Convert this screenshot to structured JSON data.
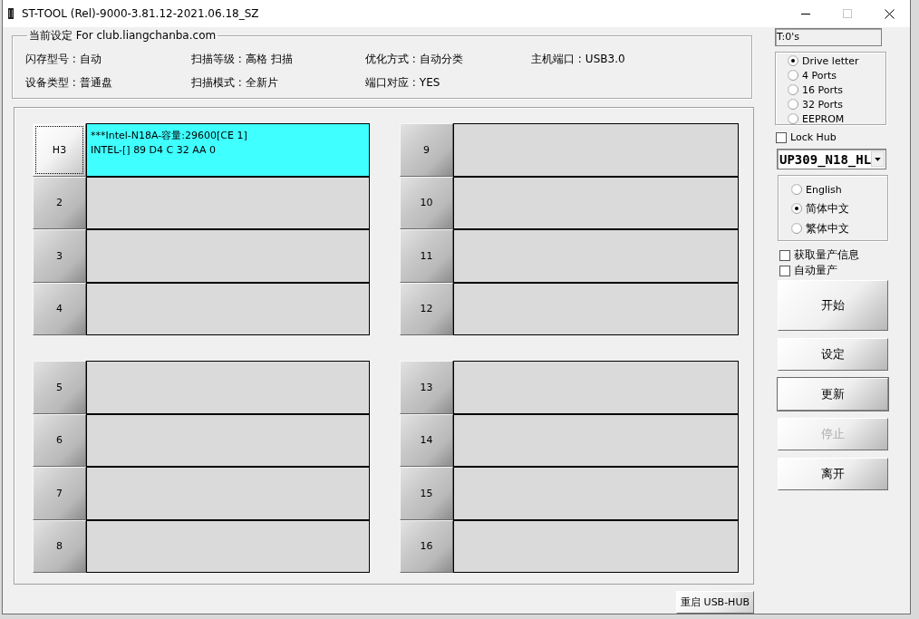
{
  "window": {
    "title": "ST-TOOL (Rel)-9000-3.81.12-2021.06.18_SZ",
    "maximize_disabled": true
  },
  "settings": {
    "title": "当前设定 For club.liangchanba.com",
    "fields": [
      {
        "label": "闪存型号 :",
        "value": "自动"
      },
      {
        "label": "扫描等级 :",
        "value": "高格 扫描"
      },
      {
        "label": "优化方式 :",
        "value": "自动分类"
      },
      {
        "label": "主机端口 :",
        "value": "USB3.0"
      },
      {
        "label": "设备类型 :",
        "value": "普通盘"
      },
      {
        "label": "扫描模式 :",
        "value": "全新片"
      },
      {
        "label": "端口对应 :",
        "value": "YES"
      }
    ]
  },
  "port_groups": [
    {
      "ports": [
        {
          "label": "H3",
          "focused": true,
          "connected": true,
          "lines": [
            "***Intel-N18A-容量:29600[CE 1]",
            "INTEL-[] 89 D4 C 32 AA 0"
          ]
        },
        {
          "label": "2",
          "focused": false,
          "connected": false
        },
        {
          "label": "3",
          "focused": false,
          "connected": false
        },
        {
          "label": "4",
          "focused": false,
          "connected": false
        }
      ]
    },
    {
      "ports": [
        {
          "label": "9",
          "focused": false,
          "connected": false
        },
        {
          "label": "10",
          "focused": false,
          "connected": false
        },
        {
          "label": "11",
          "focused": false,
          "connected": false
        },
        {
          "label": "12",
          "focused": false,
          "connected": false
        }
      ]
    },
    {
      "ports": [
        {
          "label": "5",
          "focused": false,
          "connected": false
        },
        {
          "label": "6",
          "focused": false,
          "connected": false
        },
        {
          "label": "7",
          "focused": false,
          "connected": false
        },
        {
          "label": "8",
          "focused": false,
          "connected": false
        }
      ]
    },
    {
      "ports": [
        {
          "label": "13",
          "focused": false,
          "connected": false
        },
        {
          "label": "14",
          "focused": false,
          "connected": false
        },
        {
          "label": "15",
          "focused": false,
          "connected": false
        },
        {
          "label": "16",
          "focused": false,
          "connected": false
        }
      ]
    }
  ],
  "reset_hub_button": {
    "label": "重启 USB-HUB"
  },
  "timer": {
    "value": "T:0's"
  },
  "mode_options": [
    {
      "label": "Drive letter",
      "selected": true
    },
    {
      "label": "4 Ports",
      "selected": false
    },
    {
      "label": "16 Ports",
      "selected": false
    },
    {
      "label": "32 Ports",
      "selected": false
    },
    {
      "label": "EEPROM",
      "selected": false
    }
  ],
  "lock_hub": {
    "label": "Lock Hub",
    "checked": false
  },
  "hub_select": {
    "value": "UP309_N18_HL"
  },
  "language_options": [
    {
      "label": "English",
      "selected": false
    },
    {
      "label": "简体中文",
      "selected": true
    },
    {
      "label": "繁体中文",
      "selected": false
    }
  ],
  "options": [
    {
      "label": "获取量产信息",
      "checked": false
    },
    {
      "label": "自动量产",
      "checked": false
    }
  ],
  "buttons": [
    {
      "label": "开始",
      "disabled": false,
      "default": false
    },
    {
      "label": "设定",
      "disabled": false,
      "default": false
    },
    {
      "label": "更新",
      "disabled": false,
      "default": true
    },
    {
      "label": "停止",
      "disabled": true,
      "default": false
    },
    {
      "label": "离开",
      "disabled": false,
      "default": false
    }
  ]
}
